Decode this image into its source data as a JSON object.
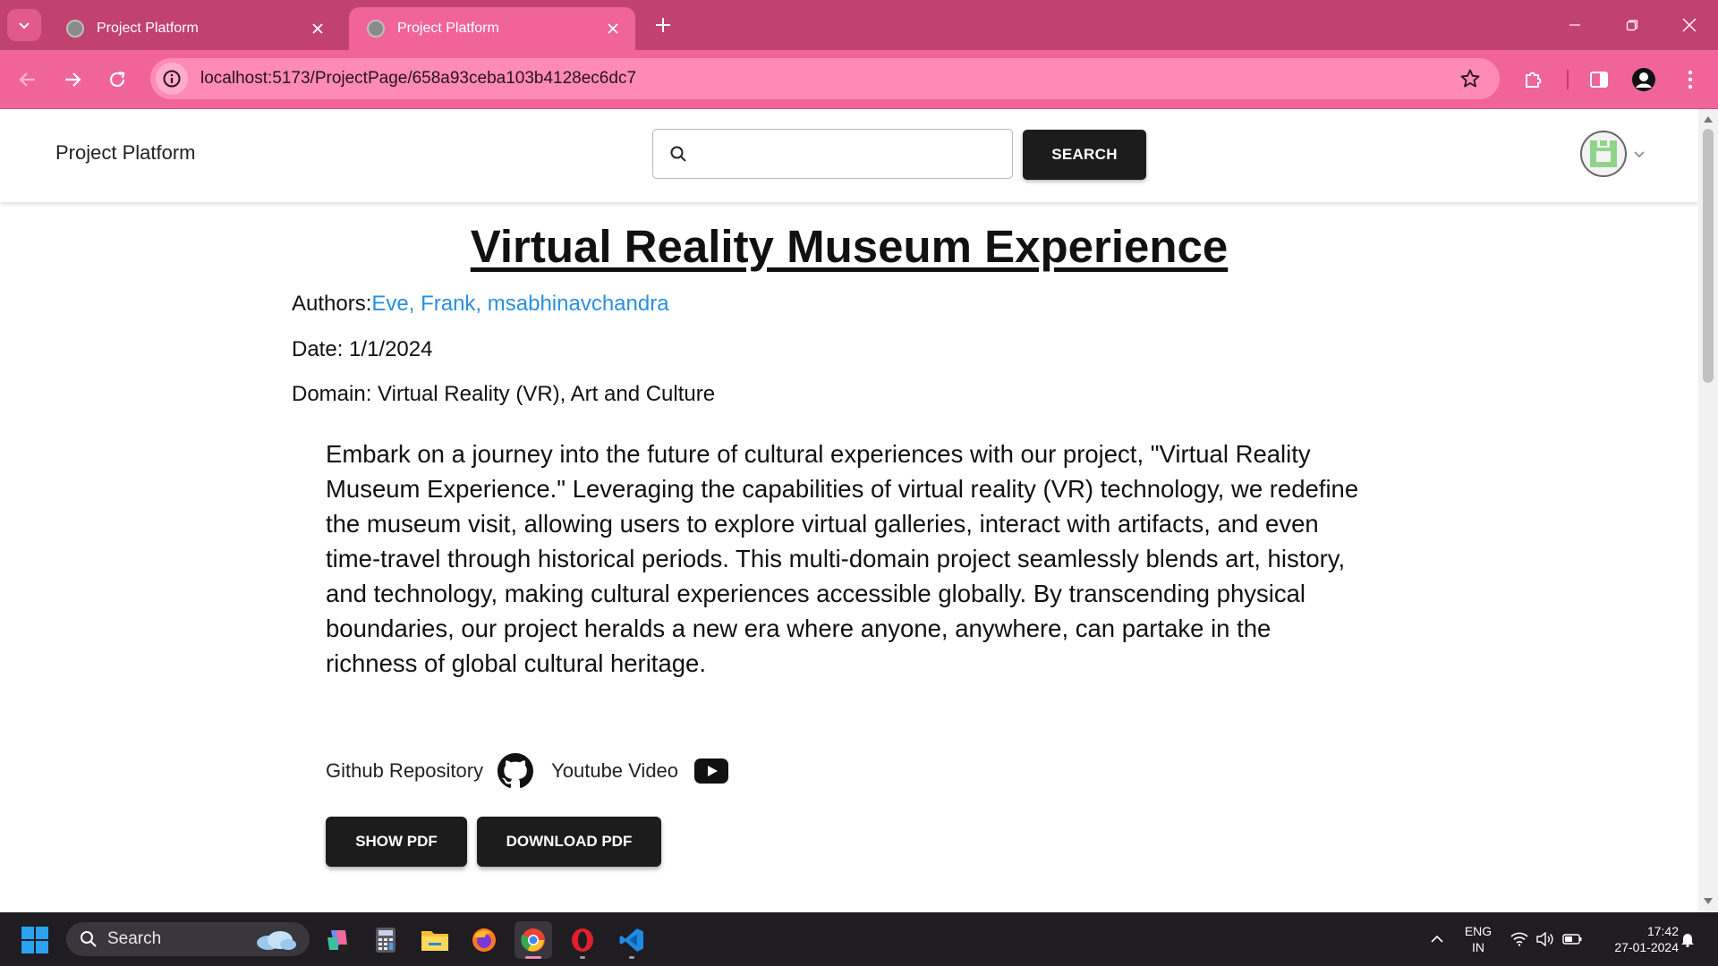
{
  "browser": {
    "tabs": [
      {
        "title": "Project Platform",
        "active": false
      },
      {
        "title": "Project Platform",
        "active": true
      }
    ],
    "url": "localhost:5173/ProjectPage/658a93ceba103b4128ec6dc7",
    "accent": "#c2426f",
    "toolbar_color": "#f0649a"
  },
  "header": {
    "brand": "Project Platform",
    "search": {
      "value": "",
      "placeholder": ""
    },
    "search_button": "SEARCH"
  },
  "project": {
    "title": "Virtual Reality Museum Experience",
    "authors_label": "Authors:",
    "authors": "Eve, Frank, msabhinavchandra",
    "date_label": "Date:",
    "date": "1/1/2024",
    "domain_label": "Domain:",
    "domain": "Virtual Reality (VR), Art and Culture",
    "description": "Embark on a journey into the future of cultural experiences with our project, \"Virtual Reality Museum Experience.\" Leveraging the capabilities of virtual reality (VR) technology, we redefine the museum visit, allowing users to explore virtual galleries, interact with artifacts, and even time-travel through historical periods. This multi-domain project seamlessly blends art, history, and technology, making cultural experiences accessible globally. By transcending physical boundaries, our project heralds a new era where anyone, anywhere, can partake in the richness of global cultural heritage.",
    "github_label": "Github Repository",
    "youtube_label": "Youtube Video",
    "show_pdf": "SHOW PDF",
    "download_pdf": "DOWNLOAD PDF",
    "link_color": "#2b8fdf"
  },
  "taskbar": {
    "search_label": "Search",
    "apps": [
      "copilot-icon",
      "calculator-icon",
      "file-explorer-icon",
      "firefox-icon",
      "chrome-icon",
      "opera-icon",
      "vscode-icon"
    ],
    "language": "ENG",
    "region": "IN",
    "time": "17:42",
    "date": "27-01-2024"
  }
}
